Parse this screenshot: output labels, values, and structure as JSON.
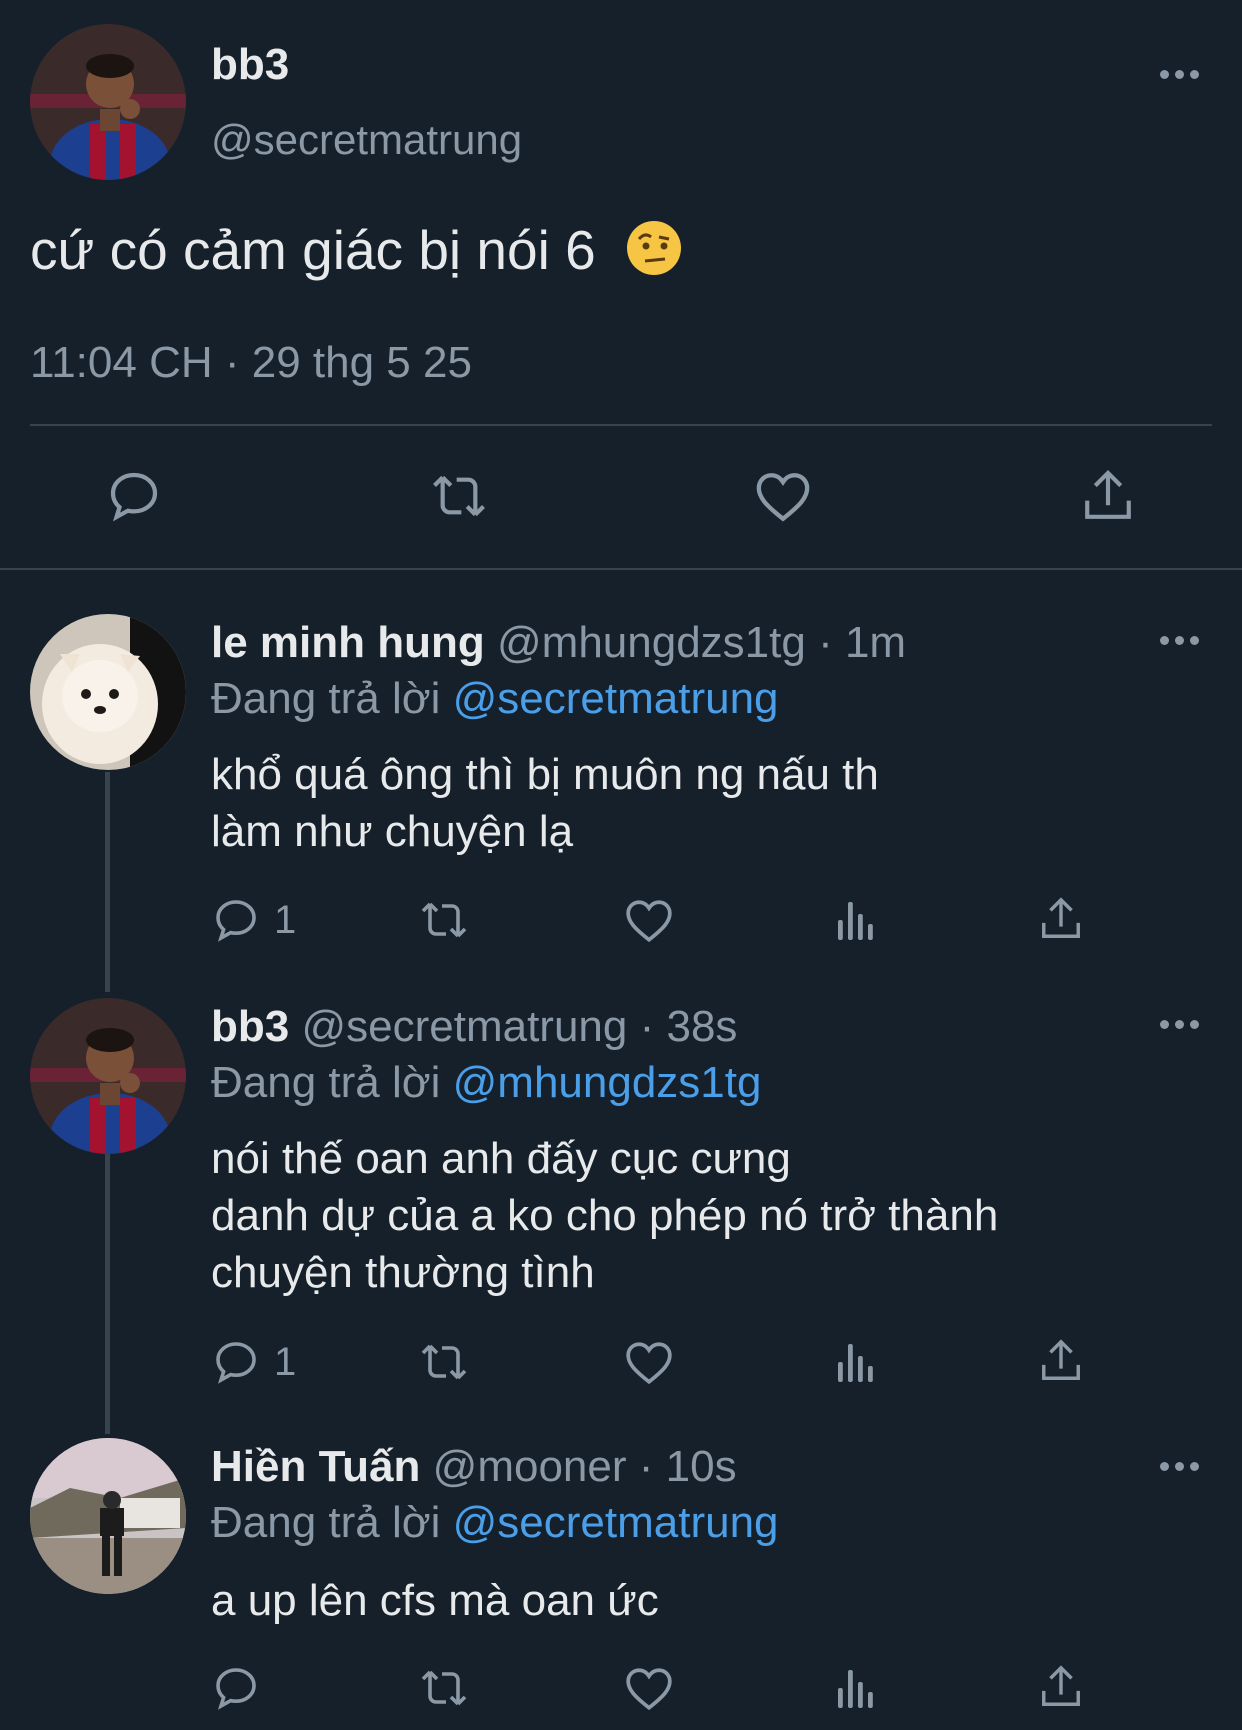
{
  "main_tweet": {
    "name": "bb3",
    "handle": "@secretmatrung",
    "text": "cứ có cảm giác bị nói 6",
    "emoji": "face-with-raised-eyebrow",
    "timestamp": "11:04 CH · 29 thg 5 25",
    "actions": [
      "reply-icon",
      "retweet-icon",
      "like-icon",
      "share-icon"
    ]
  },
  "replies": [
    {
      "name": "le minh hung",
      "handle": "@mhungdzs1tg",
      "time": "· 1m",
      "replying_prefix": "Đang trả lời",
      "replying_to": "@secretmatrung",
      "line1": "khổ quá ông thì bị muôn ng nấu th",
      "line2": "làm như chuyện lạ",
      "line3": "",
      "reply_count": "1"
    },
    {
      "name": "bb3",
      "handle": "@secretmatrung",
      "time": "· 38s",
      "replying_prefix": "Đang trả lời",
      "replying_to": "@mhungdzs1tg",
      "line1": "nói thế oan anh đấy cục cưng",
      "line2": "danh dự của a ko cho phép nó trở thành",
      "line3": "chuyện thường tình",
      "reply_count": "1"
    },
    {
      "name": "Hiền Tuấn",
      "handle": "@mooner",
      "time": "· 10s",
      "replying_prefix": "Đang trả lời",
      "replying_to": "@secretmatrung",
      "line1": "a up lên cfs mà oan ức",
      "line2": "",
      "line3": "",
      "reply_count": ""
    }
  ],
  "colors": {
    "background": "#15202b",
    "text": "#e7e9ea",
    "muted": "#8b98a5",
    "link": "#4a9fe8",
    "divider": "#38444d"
  }
}
